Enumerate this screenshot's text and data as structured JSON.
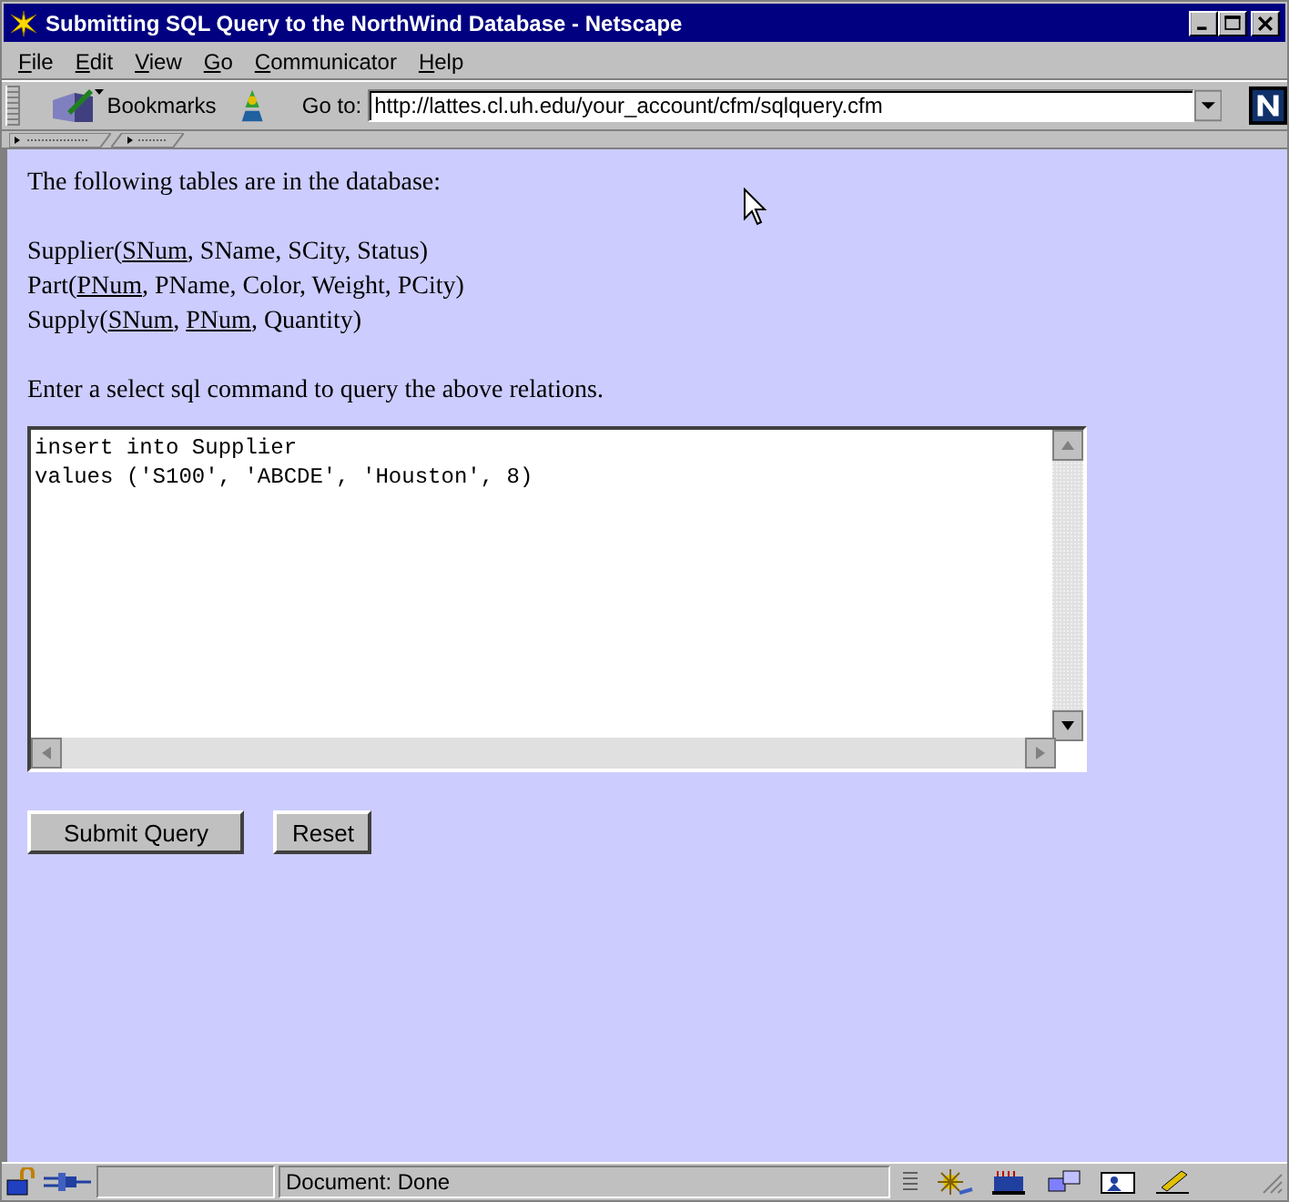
{
  "window": {
    "title": "Submitting SQL Query to the NorthWind Database - Netscape"
  },
  "menu": [
    {
      "label": "File"
    },
    {
      "label": "Edit"
    },
    {
      "label": "View"
    },
    {
      "label": "Go"
    },
    {
      "label": "Communicator"
    },
    {
      "label": "Help"
    }
  ],
  "toolbar": {
    "bookmarks_label": "Bookmarks",
    "goto_label": "Go to:",
    "url": "http://lattes.cl.uh.edu/your_account/cfm/sqlquery.cfm"
  },
  "content": {
    "intro": "The following tables are in the database:",
    "relations": [
      {
        "segments": [
          {
            "text": "Supplier(",
            "underlined": false
          },
          {
            "text": "SNum",
            "underlined": true
          },
          {
            "text": ", SName, SCity, Status)",
            "underlined": false
          }
        ]
      },
      {
        "segments": [
          {
            "text": "Part(",
            "underlined": false
          },
          {
            "text": "PNum",
            "underlined": true
          },
          {
            "text": ", PName, Color, Weight, PCity)",
            "underlined": false
          }
        ]
      },
      {
        "segments": [
          {
            "text": "Supply(",
            "underlined": false
          },
          {
            "text": "SNum",
            "underlined": true
          },
          {
            "text": ", ",
            "underlined": false
          },
          {
            "text": "PNum",
            "underlined": true
          },
          {
            "text": ", Quantity)",
            "underlined": false
          }
        ]
      }
    ],
    "prompt": "Enter a select sql command to query the above relations.",
    "query": "insert into Supplier\nvalues ('S100', 'ABCDE', 'Houston', 8)",
    "buttons": [
      {
        "label": "Submit Query"
      },
      {
        "label": "Reset"
      }
    ]
  },
  "status_bar": {
    "text": "Document: Done"
  }
}
